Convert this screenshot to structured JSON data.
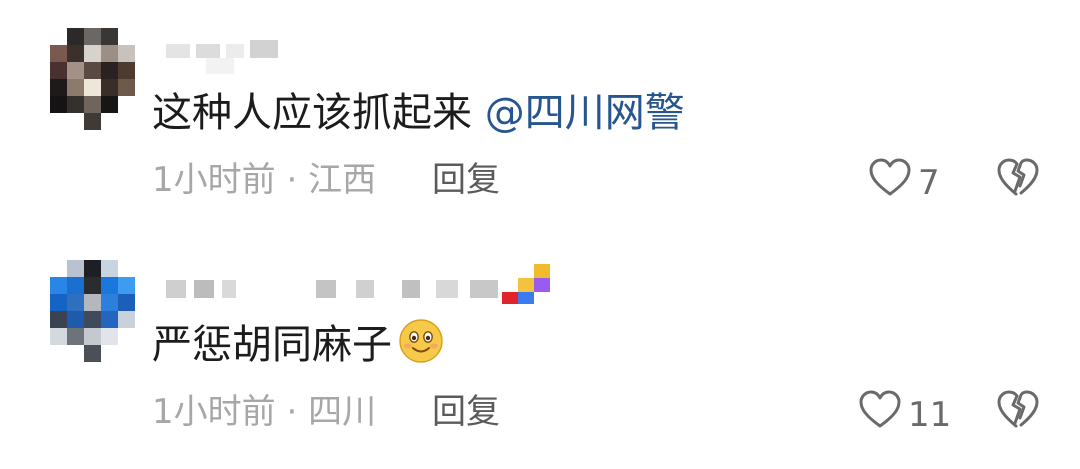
{
  "comments": [
    {
      "content_text": "这种人应该抓起来",
      "mention": "@四川网警",
      "time": "1小时前",
      "location": "江西",
      "reply_label": "回复",
      "like_count": "7"
    },
    {
      "content_text": "严惩胡同麻子",
      "time": "1小时前",
      "location": "四川",
      "reply_label": "回复",
      "like_count": "11"
    }
  ],
  "separator": "·",
  "icons": {
    "like": "heart-outline-icon",
    "dislike": "broken-heart-icon",
    "emoji": "smiling-face-emoji"
  },
  "colors": {
    "mention": "#27558f",
    "meta_text": "#a7a7a7",
    "icon_stroke": "#6a6a6a"
  }
}
